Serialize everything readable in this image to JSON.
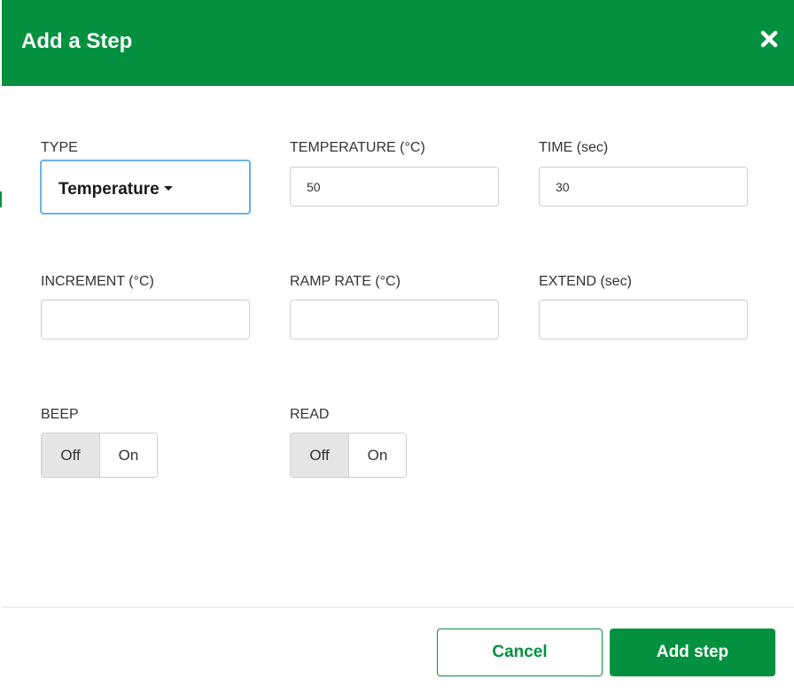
{
  "dialog": {
    "title": "Add a Step",
    "close_icon": "close-x-icon"
  },
  "fields": {
    "type": {
      "label": "TYPE",
      "value": "Temperature"
    },
    "temperature": {
      "label": "TEMPERATURE (°C)",
      "value": "50",
      "placeholder": ""
    },
    "time": {
      "label": "TIME (sec)",
      "value": "30",
      "placeholder": ""
    },
    "increment": {
      "label": "INCREMENT (°C)",
      "value": "",
      "placeholder": ""
    },
    "ramp_rate": {
      "label": "RAMP RATE (°C)",
      "value": "",
      "placeholder": ""
    },
    "extend": {
      "label": "EXTEND (sec)",
      "value": "",
      "placeholder": ""
    }
  },
  "toggles": {
    "beep": {
      "label": "BEEP",
      "off_label": "Off",
      "on_label": "On",
      "selected": "Off"
    },
    "read": {
      "label": "READ",
      "off_label": "Off",
      "on_label": "On",
      "selected": "Off"
    }
  },
  "footer": {
    "cancel_label": "Cancel",
    "submit_label": "Add step"
  },
  "colors": {
    "brand_green": "#03913f",
    "focus_blue": "#6cb2e8",
    "toggle_selected_bg": "#e6e6e6"
  }
}
